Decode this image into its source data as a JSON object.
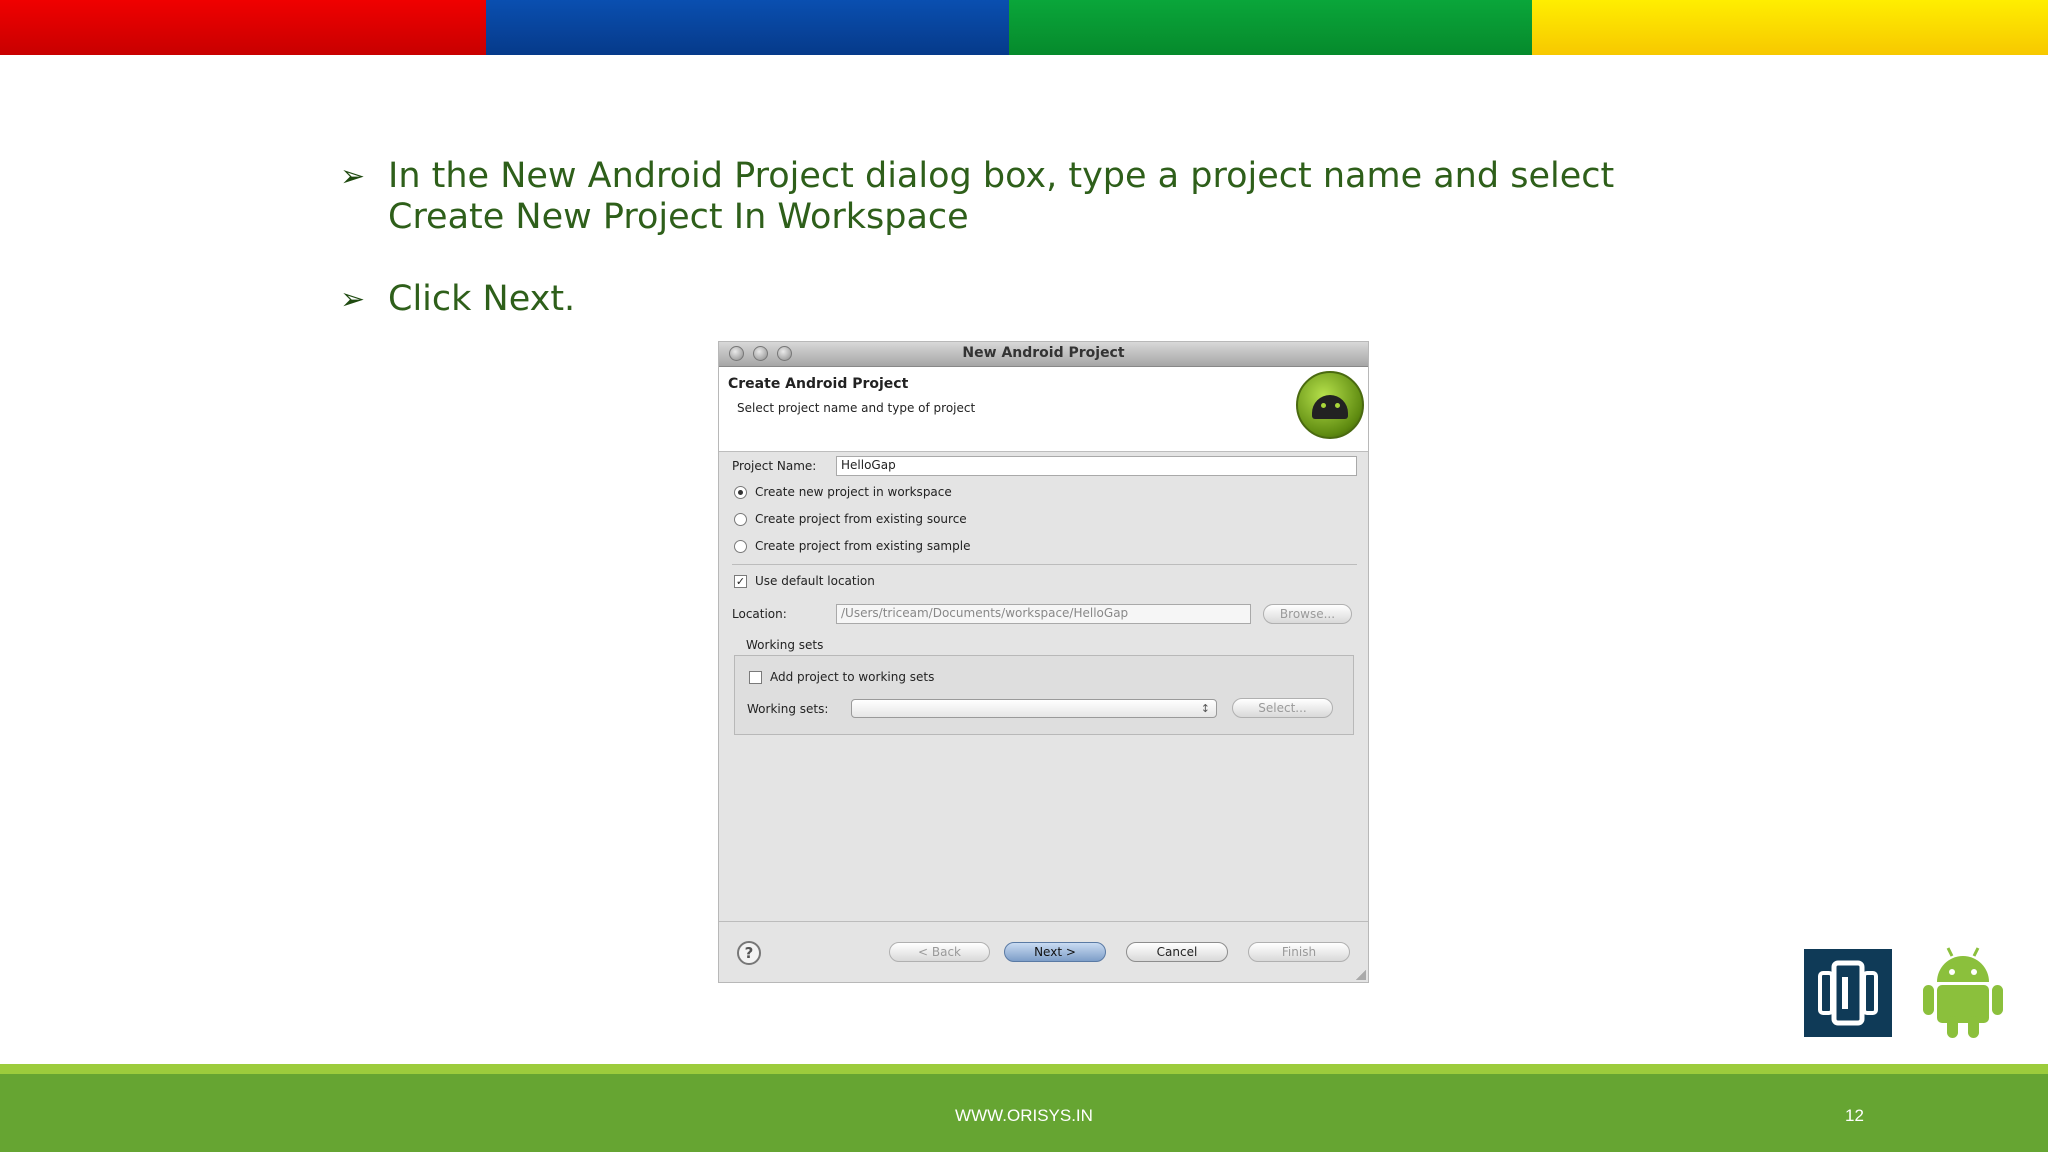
{
  "colors": {
    "accent_text": "#2e5f1a",
    "footer_green": "#66a532",
    "footer_stripe": "#9ccc3c"
  },
  "slide": {
    "bullets": [
      "In the New Android Project dialog box, type a project name and select Create New Project In Workspace",
      "Click Next."
    ],
    "footer_url": "WWW.ORISYS.IN",
    "page_number": "12"
  },
  "dialog": {
    "window_title": "New Android Project",
    "header_title": "Create Android Project",
    "header_subtitle": "Select project name and type of project",
    "project_name_label": "Project Name:",
    "project_name_value": "HelloGap",
    "radio_options": [
      {
        "label": "Create new project in workspace",
        "selected": true
      },
      {
        "label": "Create project from existing source",
        "selected": false
      },
      {
        "label": "Create project from existing sample",
        "selected": false
      }
    ],
    "use_default_location_label": "Use default location",
    "use_default_location_checked": true,
    "location_label": "Location:",
    "location_value": "/Users/triceam/Documents/workspace/HelloGap",
    "browse_label": "Browse...",
    "working_sets_group_label": "Working sets",
    "add_to_working_sets_label": "Add project to working sets",
    "add_to_working_sets_checked": false,
    "working_sets_label": "Working sets:",
    "select_label": "Select...",
    "buttons": {
      "back": "< Back",
      "next": "Next >",
      "cancel": "Cancel",
      "finish": "Finish"
    },
    "help_glyph": "?"
  },
  "icons": {
    "bullet": "arrowhead-icon",
    "brand_left": "phonegap-icon",
    "brand_right": "android-robot-icon"
  }
}
